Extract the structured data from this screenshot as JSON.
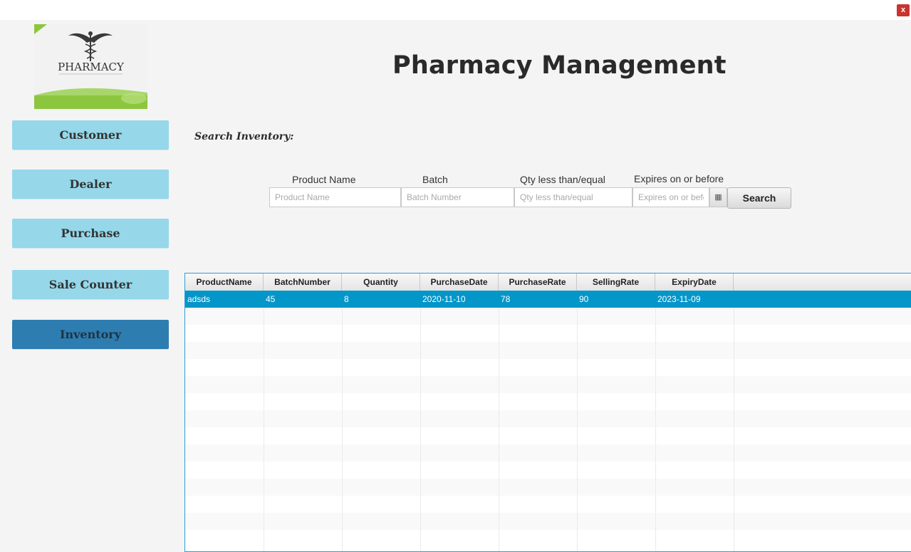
{
  "window": {
    "close_label": "x"
  },
  "logo": {
    "text": "PHARMACY"
  },
  "app_title": "Pharmacy Management",
  "sidebar": {
    "items": [
      {
        "label": "Customer",
        "active": false
      },
      {
        "label": "Dealer",
        "active": false
      },
      {
        "label": "Purchase",
        "active": false
      },
      {
        "label": "Sale Counter",
        "active": false
      },
      {
        "label": "Inventory",
        "active": true
      }
    ]
  },
  "search": {
    "heading": "Search Inventory:",
    "fields": [
      {
        "label": "Product Name",
        "placeholder": "Product Name",
        "value": ""
      },
      {
        "label": "Batch",
        "placeholder": "Batch Number",
        "value": ""
      },
      {
        "label": "Qty less than/equal",
        "placeholder": "Qty less than/equal",
        "value": ""
      },
      {
        "label": "Expires on or before",
        "placeholder": "Expires on or befc",
        "value": ""
      }
    ],
    "button_label": "Search"
  },
  "table": {
    "columns": [
      "ProductName",
      "BatchNumber",
      "Quantity",
      "PurchaseDate",
      "PurchaseRate",
      "SellingRate",
      "ExpiryDate"
    ],
    "rows": [
      [
        "adsds",
        "45",
        "8",
        "2020-11-10",
        "78",
        "90",
        "2023-11-09"
      ]
    ],
    "selected_row": 0
  },
  "colors": {
    "nav": "#96d7ea",
    "nav_active": "#2e7db1",
    "selection": "#0396c9",
    "table_border": "#2a9fd8"
  }
}
